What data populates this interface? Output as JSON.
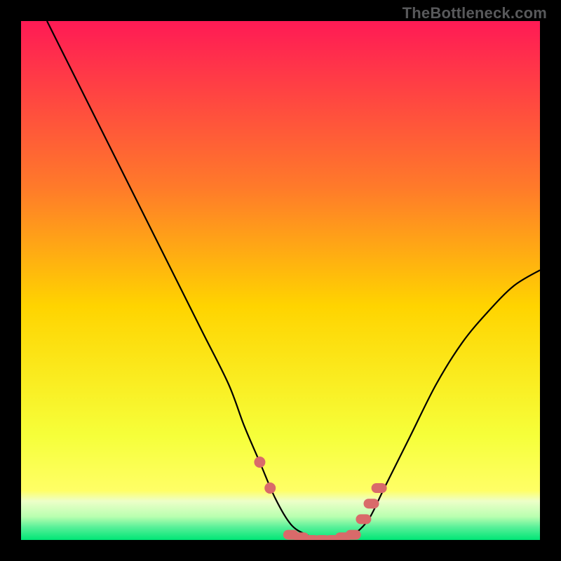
{
  "watermark": "TheBottleneck.com",
  "colors": {
    "gradient_top": "#ff1a55",
    "gradient_mid_upper": "#ff7a2a",
    "gradient_mid": "#ffd400",
    "gradient_mid_lower": "#f6ff3a",
    "gradient_band": "#edffc8",
    "gradient_bottom": "#00e676",
    "curve": "#000000",
    "marker": "#d96a6a",
    "frame": "#000000"
  },
  "chart_data": {
    "type": "line",
    "title": "",
    "xlabel": "",
    "ylabel": "",
    "xlim": [
      0,
      100
    ],
    "ylim": [
      0,
      100
    ],
    "grid": false,
    "series": [
      {
        "name": "bottleneck-curve",
        "x": [
          5,
          10,
          15,
          20,
          25,
          30,
          35,
          40,
          43,
          46,
          49,
          52,
          55,
          58,
          61,
          64,
          67,
          70,
          75,
          80,
          85,
          90,
          95,
          100
        ],
        "y": [
          100,
          90,
          80,
          70,
          60,
          50,
          40,
          30,
          22,
          15,
          8,
          3,
          1,
          0,
          0,
          1,
          4,
          10,
          20,
          30,
          38,
          44,
          49,
          52
        ]
      }
    ],
    "highlight_segments": [
      {
        "name": "left-markers",
        "marker_style": "dot",
        "points": [
          {
            "x": 46,
            "y": 15
          },
          {
            "x": 48,
            "y": 10
          }
        ]
      },
      {
        "name": "trough-markers",
        "marker_style": "dash",
        "points": [
          {
            "x": 52,
            "y": 1
          },
          {
            "x": 54,
            "y": 0.5
          },
          {
            "x": 56,
            "y": 0
          },
          {
            "x": 58,
            "y": 0
          },
          {
            "x": 60,
            "y": 0
          },
          {
            "x": 62,
            "y": 0.5
          },
          {
            "x": 64,
            "y": 1
          }
        ]
      },
      {
        "name": "right-markers",
        "marker_style": "dash",
        "points": [
          {
            "x": 66,
            "y": 4
          },
          {
            "x": 67.5,
            "y": 7
          },
          {
            "x": 69,
            "y": 10
          }
        ]
      }
    ]
  }
}
